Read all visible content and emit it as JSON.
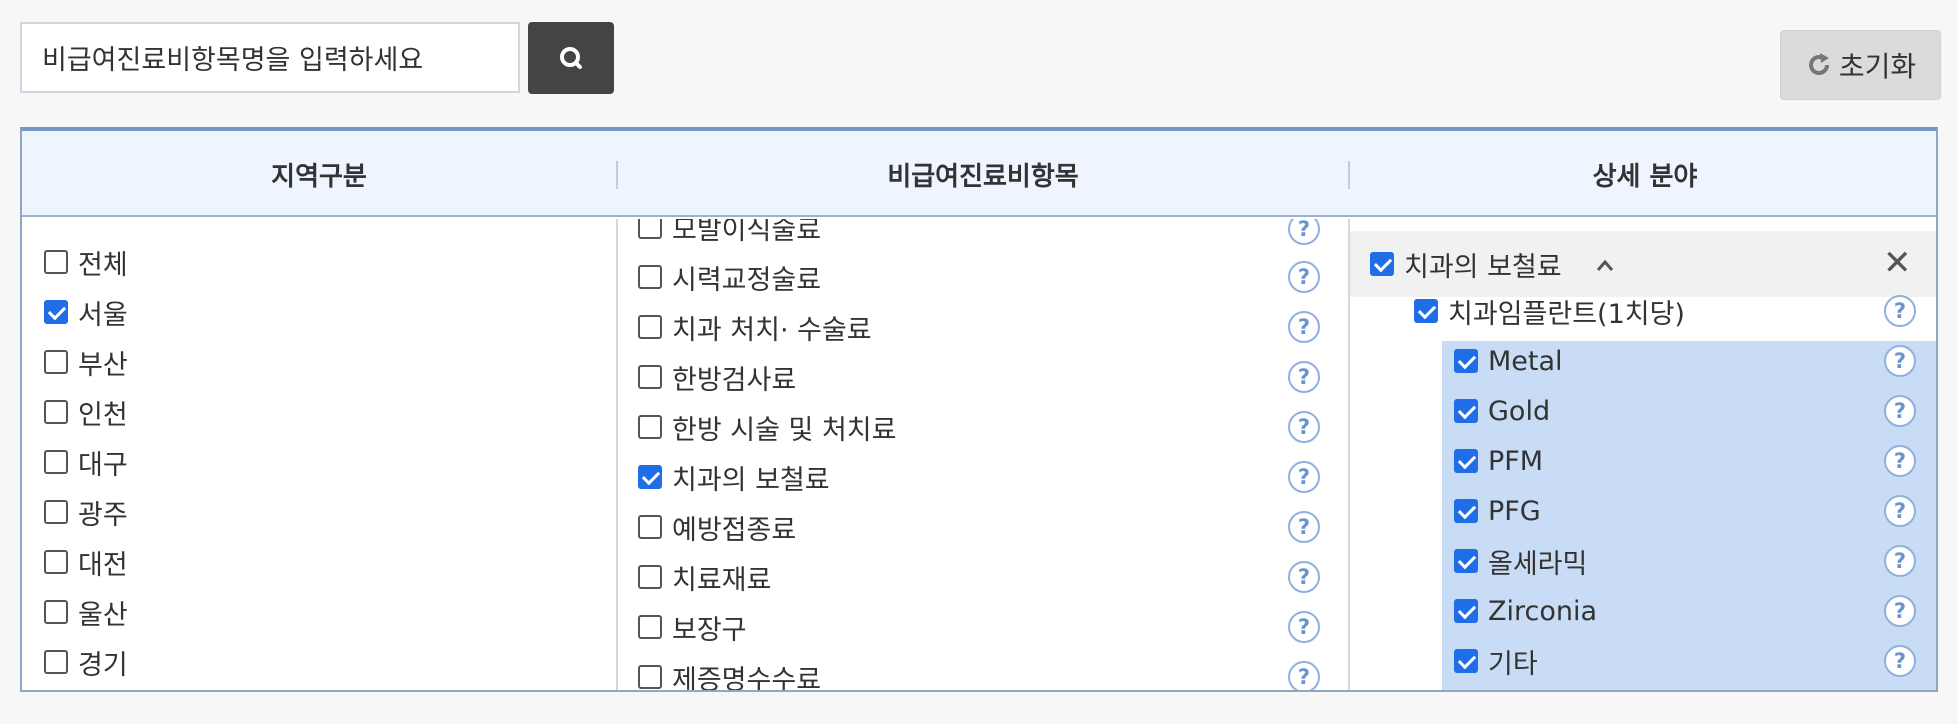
{
  "search": {
    "value": "비급여진료비항목명을 입력하세요",
    "button_icon": "search-icon"
  },
  "reset": {
    "label": "초기화",
    "icon": "refresh-icon"
  },
  "columns": {
    "region": "지역구분",
    "items": "비급여진료비항목",
    "detail": "상세 분야"
  },
  "regions": [
    {
      "label": "전체",
      "checked": false
    },
    {
      "label": "서울",
      "checked": true
    },
    {
      "label": "부산",
      "checked": false
    },
    {
      "label": "인천",
      "checked": false
    },
    {
      "label": "대구",
      "checked": false
    },
    {
      "label": "광주",
      "checked": false
    },
    {
      "label": "대전",
      "checked": false
    },
    {
      "label": "울산",
      "checked": false
    },
    {
      "label": "경기",
      "checked": false
    }
  ],
  "items": [
    {
      "label": "모발이식술료",
      "checked": false
    },
    {
      "label": "시력교정술료",
      "checked": false
    },
    {
      "label": "치과 처치· 수술료",
      "checked": false
    },
    {
      "label": "한방검사료",
      "checked": false
    },
    {
      "label": "한방 시술 및 처치료",
      "checked": false
    },
    {
      "label": "치과의 보철료",
      "checked": true
    },
    {
      "label": "예방접종료",
      "checked": false
    },
    {
      "label": "치료재료",
      "checked": false
    },
    {
      "label": "보장구",
      "checked": false
    },
    {
      "label": "제증명수수료",
      "checked": false
    }
  ],
  "detail": {
    "category": {
      "label": "치과의 보철료",
      "checked": true
    },
    "group": {
      "label": "치과임플란트(1치당)",
      "checked": true
    },
    "options": [
      {
        "label": "Metal",
        "checked": true
      },
      {
        "label": "Gold",
        "checked": true
      },
      {
        "label": "PFM",
        "checked": true
      },
      {
        "label": "PFG",
        "checked": true
      },
      {
        "label": "올세라믹",
        "checked": true
      },
      {
        "label": "Zirconia",
        "checked": true
      },
      {
        "label": "기타",
        "checked": true
      }
    ]
  },
  "help_glyph": "?",
  "close_glyph": "✕",
  "colors": {
    "accent": "#1f6ee8",
    "header_bg": "#eef5fe",
    "selected_bg": "#c9dcf5",
    "dark_button": "#444444"
  }
}
